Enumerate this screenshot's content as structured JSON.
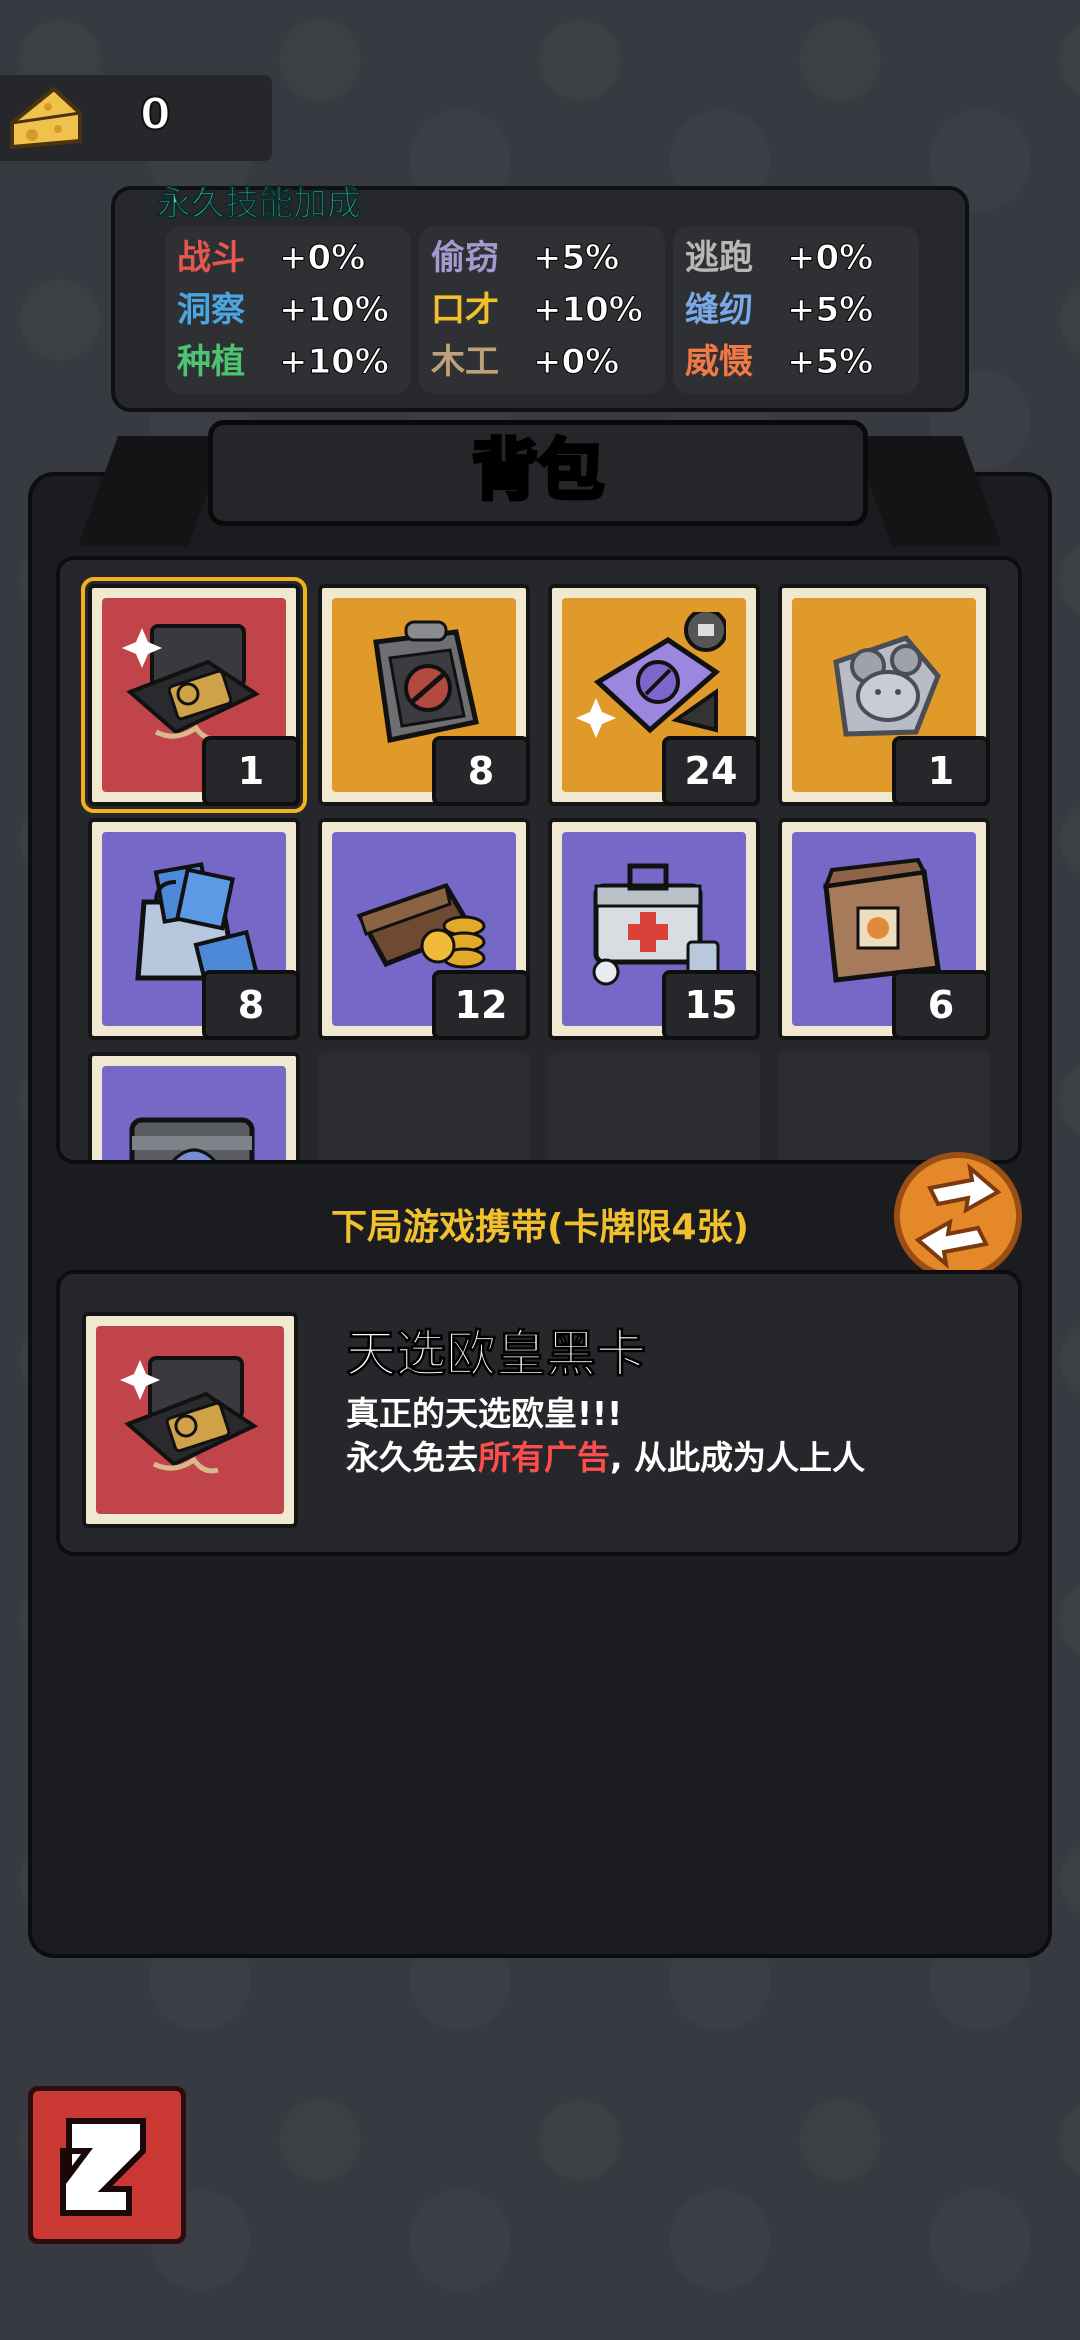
{
  "currency": {
    "icon": "cheese-icon",
    "value": "0"
  },
  "skills": {
    "title": "永久技能加成",
    "columns": [
      [
        {
          "name": "战斗",
          "value": "+0%",
          "color": "#e8574f"
        },
        {
          "name": "洞察",
          "value": "+10%",
          "color": "#4aa6e0"
        },
        {
          "name": "种植",
          "value": "+10%",
          "color": "#4cc472"
        }
      ],
      [
        {
          "name": "偷窃",
          "value": "+5%",
          "color": "#a39bd0"
        },
        {
          "name": "口才",
          "value": "+10%",
          "color": "#f2c02c"
        },
        {
          "name": "木工",
          "value": "+0%",
          "color": "#bfa07a"
        }
      ],
      [
        {
          "name": "逃跑",
          "value": "+0%",
          "color": "#b8b8b8"
        },
        {
          "name": "缝纫",
          "value": "+5%",
          "color": "#7aa9e8"
        },
        {
          "name": "威慑",
          "value": "+5%",
          "color": "#ef7a45"
        }
      ]
    ]
  },
  "pack": {
    "title": "背包"
  },
  "inventory": [
    {
      "name": "black-card-box",
      "count": "1",
      "bg": "#c0444a",
      "selected": true
    },
    {
      "name": "ad-free-box",
      "count": "8",
      "bg": "#e09a2a"
    },
    {
      "name": "purple-pack",
      "count": "24",
      "bg": "#e09a2a"
    },
    {
      "name": "mouse-statue",
      "count": "1",
      "bg": "#e09a2a"
    },
    {
      "name": "money-bag",
      "count": "8",
      "bg": "#7568c6"
    },
    {
      "name": "wallet-coins",
      "count": "12",
      "bg": "#7568c6"
    },
    {
      "name": "first-aid-kit",
      "count": "15",
      "bg": "#7568c6"
    },
    {
      "name": "paper-bag",
      "count": "6",
      "bg": "#7568c6"
    },
    {
      "name": "metal-box",
      "count": "",
      "bg": "#7568c6"
    }
  ],
  "carry": {
    "label": "下局游戏携带(卡牌限4张)",
    "swap_icon": "swap-arrows-icon"
  },
  "detail": {
    "name": "天选欧皇黑卡",
    "line1": "真正的天选欧皇!!!",
    "line2_pre": "永久免去",
    "line2_hl": "所有广告",
    "line2_post": ", 从此成为人上人"
  },
  "back": {
    "icon": "back-arrow-icon"
  }
}
